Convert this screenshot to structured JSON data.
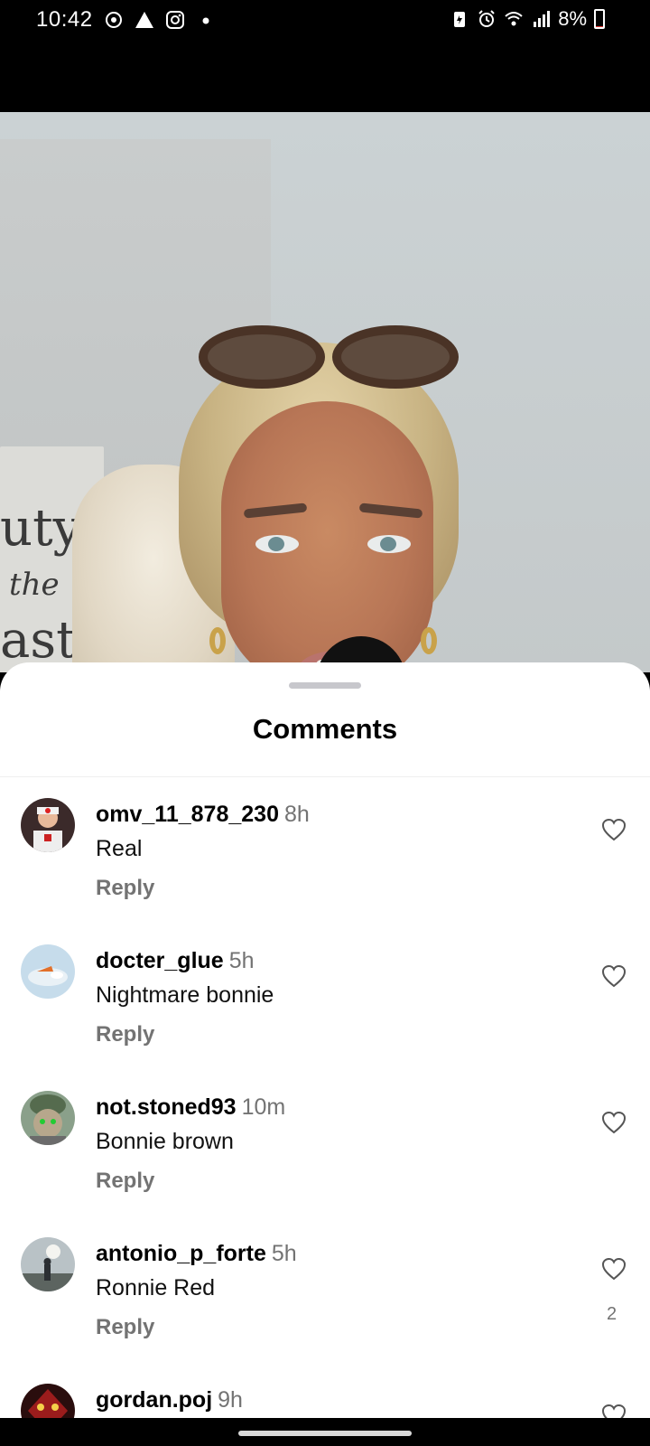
{
  "status_bar": {
    "time": "10:42",
    "battery": "8%",
    "battery_level": 0.08,
    "left_icons": [
      "sync-icon",
      "warning-icon",
      "instagram-icon",
      "dot-icon"
    ],
    "right_icons": [
      "battery-saver-icon",
      "alarm-icon",
      "wifi-icon",
      "signal-icon"
    ]
  },
  "video": {
    "poster_text": [
      "uty",
      "the",
      "ast"
    ]
  },
  "comments_sheet": {
    "title": "Comments",
    "reply_label": "Reply",
    "items": [
      {
        "username": "omv_11_878_230",
        "time": "8h",
        "text": "Real",
        "likes": ""
      },
      {
        "username": "docter_glue",
        "time": "5h",
        "text": "Nightmare bonnie",
        "likes": ""
      },
      {
        "username": "not.stoned93",
        "time": "10m",
        "text": "Bonnie brown",
        "likes": ""
      },
      {
        "username": "antonio_p_forte",
        "time": "5h",
        "text": "Ronnie Red",
        "likes": "2"
      },
      {
        "username": "gordan.poj",
        "time": "9h",
        "text": "",
        "likes": ""
      }
    ]
  },
  "colors": {
    "accent_grey": "#737373",
    "sheet_bg": "#ffffff",
    "battery_low": "#e53935"
  }
}
